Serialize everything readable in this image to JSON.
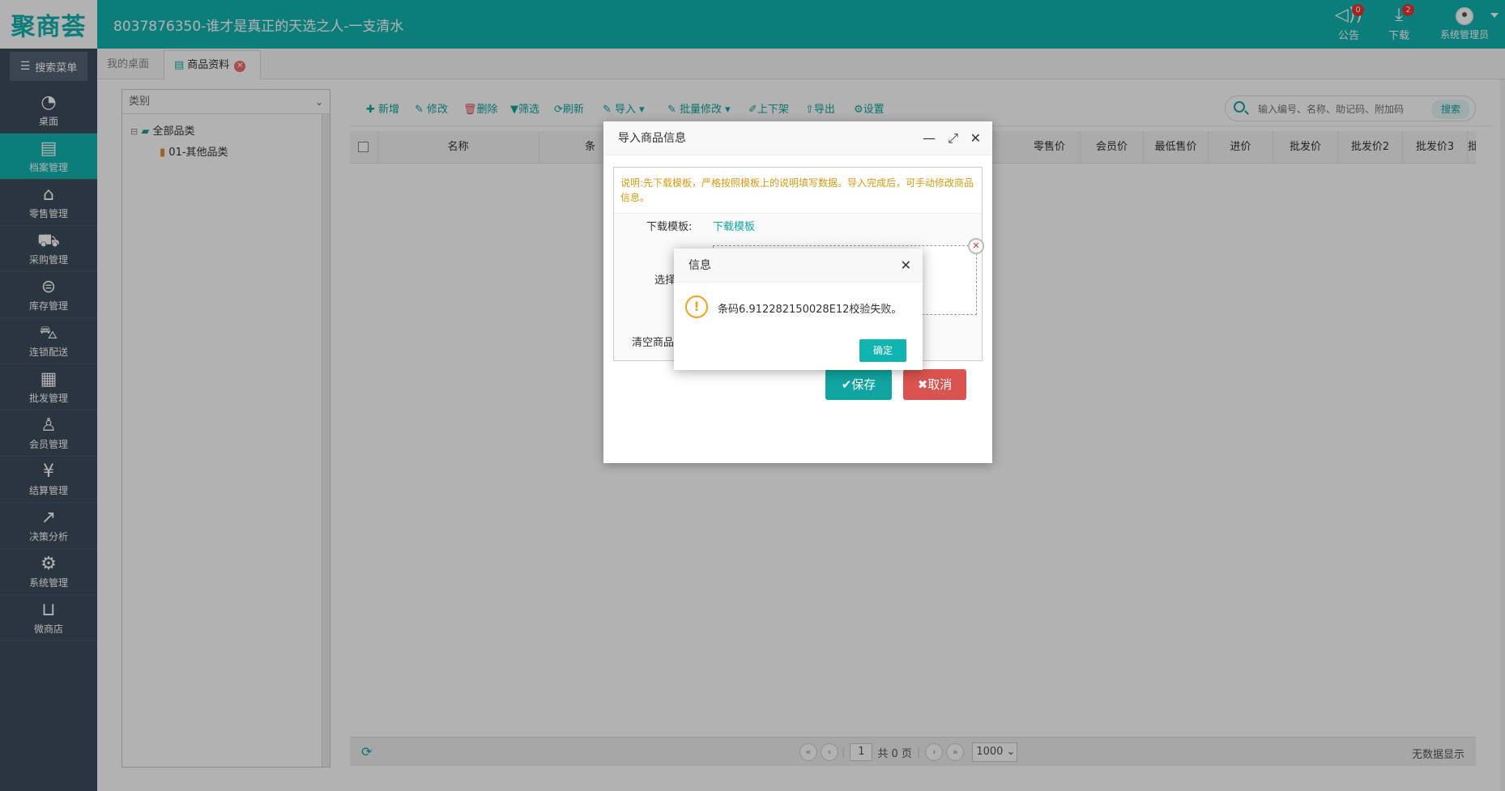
{
  "header": {
    "logo": "聚商荟",
    "title": "8037876350-谁才是真正的天选之人-一支清水",
    "notice": {
      "label": "公告",
      "badge": "0"
    },
    "download": {
      "label": "下载",
      "badge": "2"
    },
    "user": {
      "label": "系统管理员"
    }
  },
  "sidebar": {
    "search_label": "搜索菜单",
    "items": [
      {
        "label": "桌面",
        "icon": "◔"
      },
      {
        "label": "档案管理",
        "icon": "▤"
      },
      {
        "label": "零售管理",
        "icon": "⌂"
      },
      {
        "label": "采购管理",
        "icon": "⛟"
      },
      {
        "label": "库存管理",
        "icon": "⊜"
      },
      {
        "label": "连锁配送",
        "icon": "⛍"
      },
      {
        "label": "批发管理",
        "icon": "▦"
      },
      {
        "label": "会员管理",
        "icon": "♙"
      },
      {
        "label": "结算管理",
        "icon": "¥"
      },
      {
        "label": "决策分析",
        "icon": "↗"
      },
      {
        "label": "系统管理",
        "icon": "⚙"
      },
      {
        "label": "微商店",
        "icon": "⊔"
      }
    ]
  },
  "tabs": [
    {
      "label": "我的桌面"
    },
    {
      "label": "商品资料"
    }
  ],
  "tree": {
    "select_placeholder": "类别",
    "root": "全部品类",
    "child": "01-其他品类"
  },
  "toolbar": {
    "add": "新增",
    "edit": "修改",
    "delete": "删除",
    "filter": "筛选",
    "refresh": "刷新",
    "import": "导入",
    "batch_edit": "批量修改",
    "shelf": "上下架",
    "export": "导出",
    "settings": "设置",
    "search_placeholder": "输入编号、名称、助记码、附加码",
    "search_btn": "搜索"
  },
  "table": {
    "columns": [
      "名称",
      "条",
      "零售价",
      "会员价",
      "最低售价",
      "进价",
      "批发价",
      "批发价2",
      "批发价3",
      "批发"
    ]
  },
  "footer": {
    "page": "1",
    "total_pages": "共 0 页",
    "page_size": "1000",
    "status": "无数据显示"
  },
  "import_dialog": {
    "title": "导入商品信息",
    "note": "说明:先下载模板，严格按照模板上的说明填写数据。导入完成后，可手动修改商品信息。",
    "template_label": "下载模板:",
    "template_link": "下载模板",
    "select_label": "选择",
    "clear_label": "清空商品",
    "save": "保存",
    "cancel": "取消"
  },
  "info_dialog": {
    "title": "信息",
    "message": "条码6.912282150028E12校验失败。",
    "ok": "确定"
  }
}
